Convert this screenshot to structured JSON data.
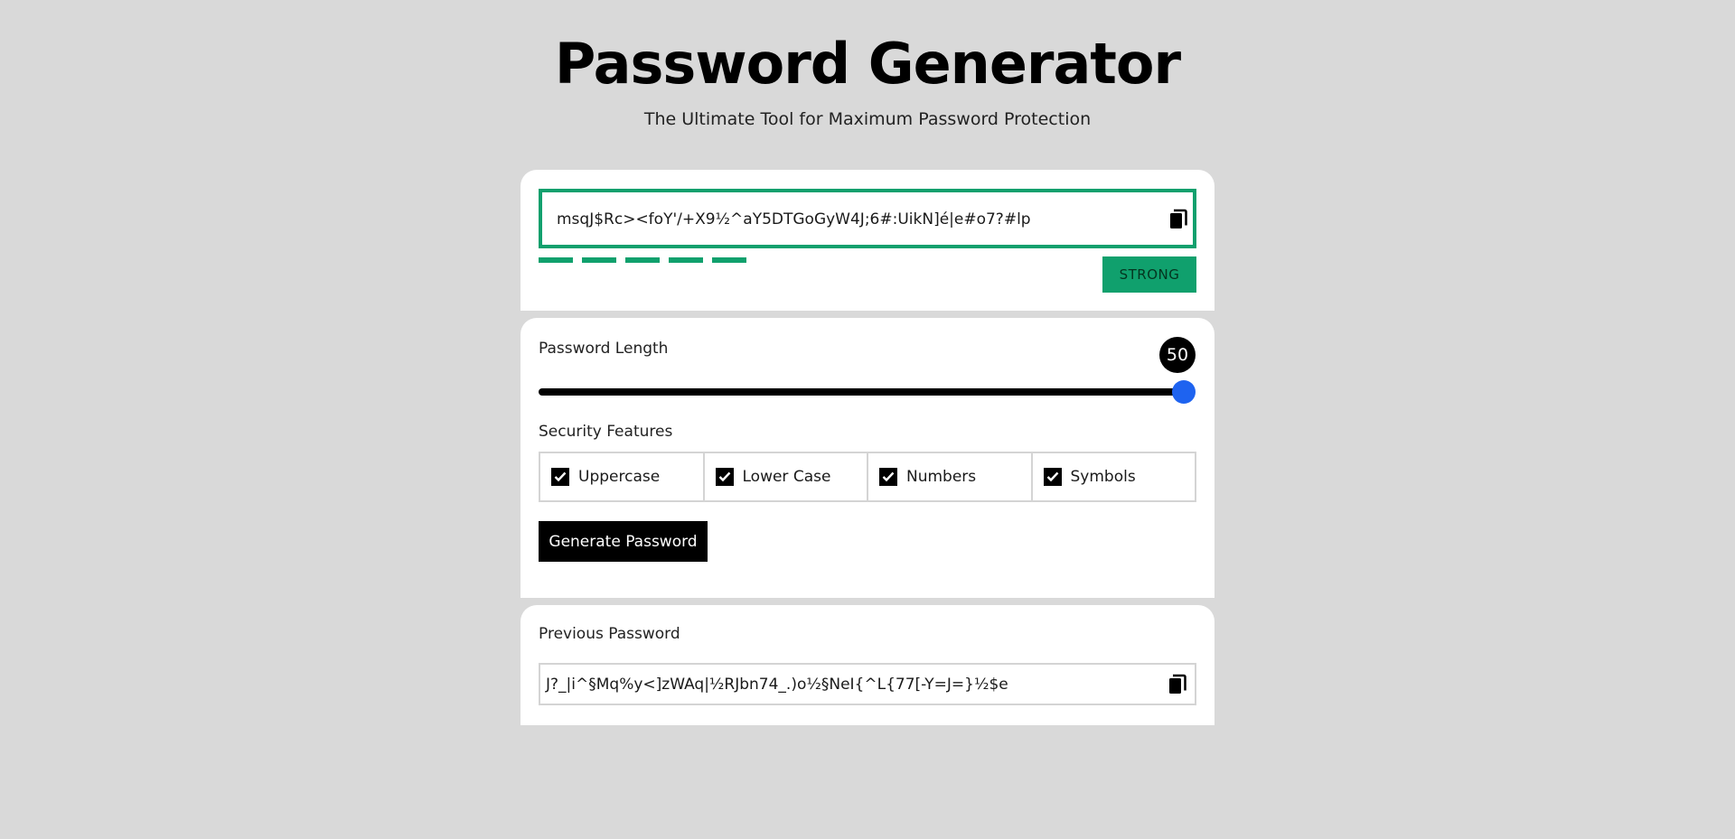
{
  "header": {
    "title": "Password Generator",
    "subtitle": "The Ultimate Tool for Maximum Password Protection"
  },
  "output": {
    "password": "msqJ$Rc><foY'/+X9½^aY5DTGoGyW4J;6#:UikN]é|e#o7?#lp",
    "copy_icon": "copy-icon",
    "strength_bar_count": 5,
    "strength_label": "STRONG",
    "strength_color": "#10a06d"
  },
  "settings": {
    "length_label": "Password Length",
    "length_value": "50",
    "slider_fraction": 1.0,
    "slider_thumb_color": "#1e63f0",
    "features_label": "Security Features",
    "features": [
      {
        "label": "Uppercase",
        "checked": true
      },
      {
        "label": "Lower Case",
        "checked": true
      },
      {
        "label": "Numbers",
        "checked": true
      },
      {
        "label": "Symbols",
        "checked": true
      }
    ],
    "generate_label": "Generate Password"
  },
  "previous": {
    "label": "Previous Password",
    "password": "J?_|i^§Mq%y<]zWAq|½RJbn74_.)o½§NeI{^L{77[-Y=J=}½$e",
    "copy_icon": "copy-icon"
  }
}
